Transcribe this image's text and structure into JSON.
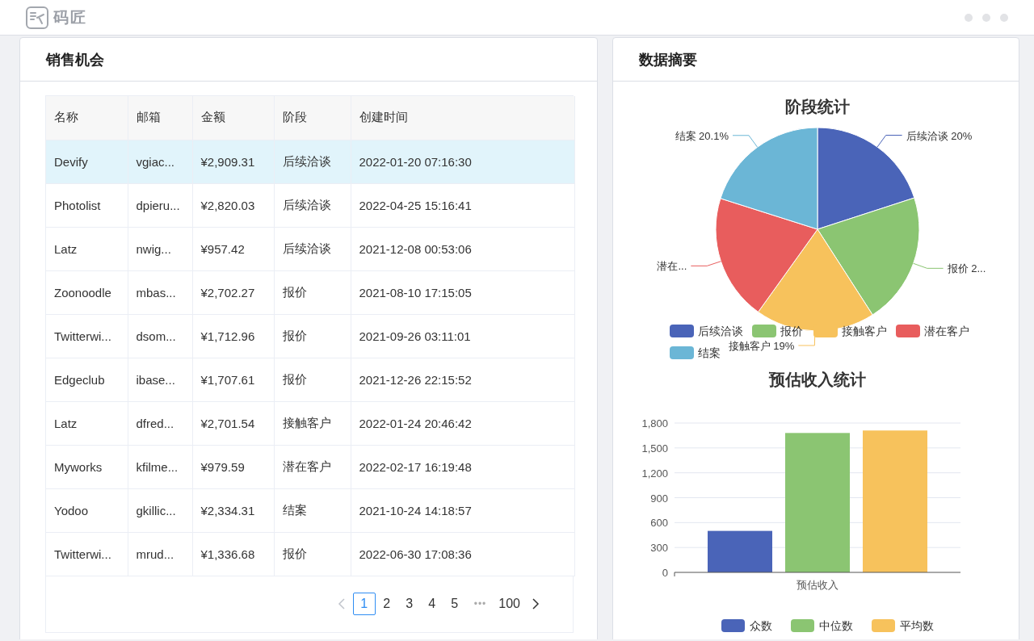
{
  "app": {
    "logo_text": "码匠"
  },
  "sales_panel": {
    "title": "销售机会",
    "table": {
      "columns": [
        "名称",
        "邮箱",
        "金额",
        "阶段",
        "创建时间"
      ],
      "rows": [
        {
          "cells": [
            "Devify",
            "vgiac...",
            "¥2,909.31",
            "后续洽谈",
            "2022-01-20 07:16:30"
          ],
          "selected": true
        },
        {
          "cells": [
            "Photolist",
            "dpieru...",
            "¥2,820.03",
            "后续洽谈",
            "2022-04-25 15:16:41"
          ],
          "selected": false
        },
        {
          "cells": [
            "Latz",
            "nwig...",
            "¥957.42",
            "后续洽谈",
            "2021-12-08 00:53:06"
          ],
          "selected": false
        },
        {
          "cells": [
            "Zoonoodle",
            "mbas...",
            "¥2,702.27",
            "报价",
            "2021-08-10 17:15:05"
          ],
          "selected": false
        },
        {
          "cells": [
            "Twitterwi...",
            "dsom...",
            "¥1,712.96",
            "报价",
            "2021-09-26 03:11:01"
          ],
          "selected": false
        },
        {
          "cells": [
            "Edgeclub",
            "ibase...",
            "¥1,707.61",
            "报价",
            "2021-12-26 22:15:52"
          ],
          "selected": false
        },
        {
          "cells": [
            "Latz",
            "dfred...",
            "¥2,701.54",
            "接触客户",
            "2022-01-24 20:46:42"
          ],
          "selected": false
        },
        {
          "cells": [
            "Myworks",
            "kfilme...",
            "¥979.59",
            "潜在客户",
            "2022-02-17 16:19:48"
          ],
          "selected": false
        },
        {
          "cells": [
            "Yodoo",
            "gkillic...",
            "¥2,334.31",
            "结案",
            "2021-10-24 14:18:57"
          ],
          "selected": false
        },
        {
          "cells": [
            "Twitterwi...",
            "mrud...",
            "¥1,336.68",
            "报价",
            "2022-06-30 17:08:36"
          ],
          "selected": false
        }
      ]
    },
    "pagination": {
      "prev_disabled": true,
      "pages": [
        {
          "label": "1",
          "selected": true
        },
        {
          "label": "2",
          "selected": false
        },
        {
          "label": "3",
          "selected": false
        },
        {
          "label": "4",
          "selected": false
        },
        {
          "label": "5",
          "selected": false
        }
      ],
      "ellipsis": "•••",
      "last_page": {
        "label": "100",
        "selected": false
      }
    }
  },
  "summary_panel": {
    "title": "数据摘要",
    "pie_chart": {
      "chart_data": {
        "type": "pie",
        "title": "阶段统计",
        "categories": [
          "后续洽谈",
          "报价",
          "接触客户",
          "潜在客户",
          "结案"
        ],
        "values": [
          20,
          20.9,
          19,
          20,
          20.1
        ],
        "legend": true,
        "colors": [
          "#4a64b8",
          "#8bc572",
          "#f7c25c",
          "#e85d5d",
          "#6bb6d6"
        ],
        "value_labels": [
          "后续洽谈 20%",
          "报价 2...",
          "接触客户 19%",
          "潜在...",
          "结案 20.1%"
        ]
      }
    },
    "bar_chart": {
      "chart_data": {
        "type": "bar",
        "title": "预估收入统计",
        "categories": [
          "预估收入"
        ],
        "series": [
          {
            "name": "众数",
            "color": "#4a64b8",
            "values": [
              500
            ]
          },
          {
            "name": "中位数",
            "color": "#8bc572",
            "values": [
              1680
            ]
          },
          {
            "name": "平均数",
            "color": "#f7c25c",
            "values": [
              1710
            ]
          }
        ],
        "ylim": [
          0,
          1800
        ],
        "grid": true,
        "legend": true,
        "yticks": [
          {
            "value": 0,
            "label": "0"
          },
          {
            "value": 300,
            "label": "300"
          },
          {
            "value": 600,
            "label": "600"
          },
          {
            "value": 900,
            "label": "900"
          },
          {
            "value": 1200,
            "label": "1,200"
          },
          {
            "value": 1500,
            "label": "1,500"
          },
          {
            "value": 1800,
            "label": "1,800"
          }
        ]
      }
    }
  }
}
